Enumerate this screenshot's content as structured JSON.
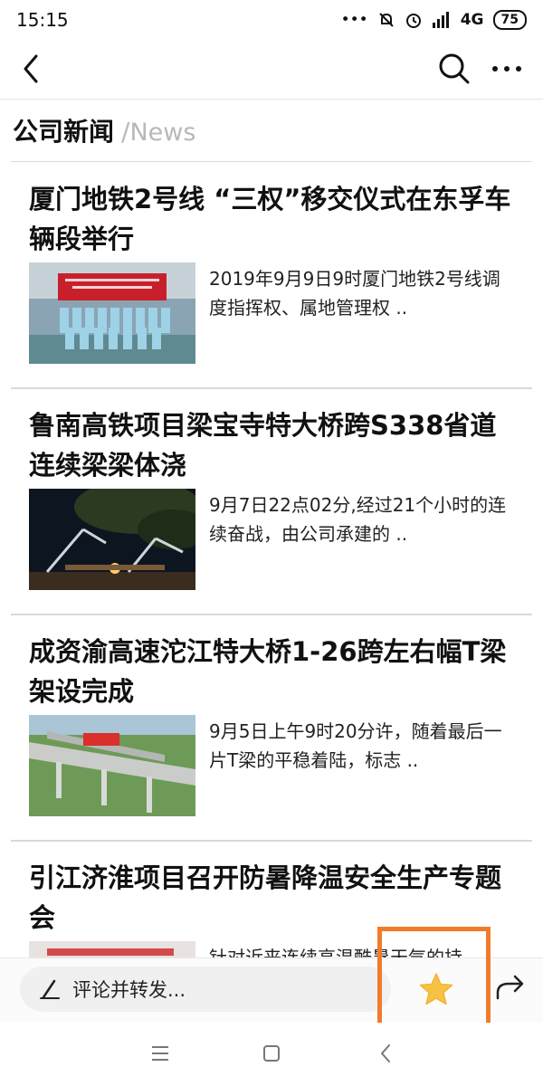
{
  "status_bar": {
    "time": "15:15",
    "signal_label": "4G",
    "battery_level": "75"
  },
  "section": {
    "title": "公司新闻",
    "separator": "/",
    "subtitle": "News"
  },
  "articles": [
    {
      "title": "厦门地铁2号线 “三权”移交仪式在东孚车辆段举行",
      "excerpt": "2019年9月9日9时厦门地铁2号线调度指挥权、属地管理权 .."
    },
    {
      "title": "鲁南高铁项目梁宝寺特大桥跨S338省道连续梁梁体浇",
      "excerpt": "9月7日22点02分,经过21个小时的连续奋战，由公司承建的 .."
    },
    {
      "title": "成资渝高速沱江特大桥1-26跨左右幅T梁架设完成",
      "excerpt": "9月5日上午9时20分许，随着最后一片T梁的平稳着陆，标志 .."
    },
    {
      "title": "引江济淮项目召开防暑降温安全生产专题会",
      "excerpt": "针对近来连续高温酷暑天气的持"
    }
  ],
  "comment_bar": {
    "placeholder": "评论并转发..."
  },
  "colors": {
    "highlight": "#f07c2b",
    "star": "#f7c244",
    "subtitle": "#b8b8b8"
  },
  "icons": [
    "back-icon",
    "search-icon",
    "more-icon",
    "pen-icon",
    "star-icon",
    "share-icon",
    "menu-icon",
    "home-icon",
    "system-back-icon"
  ]
}
